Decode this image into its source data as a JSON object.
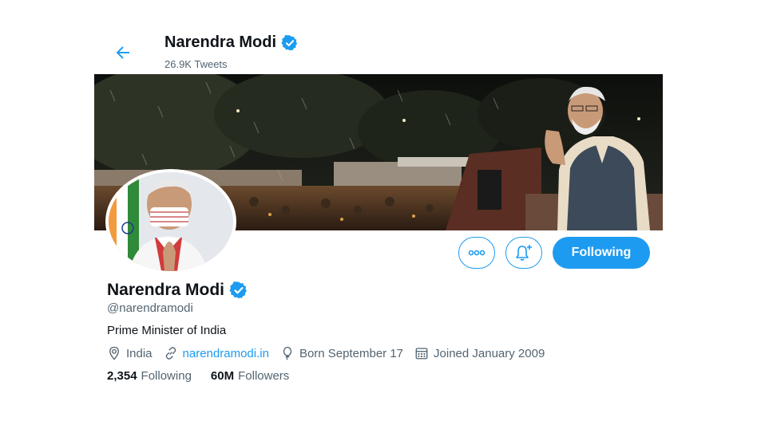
{
  "header": {
    "name": "Narendra Modi",
    "tweets_count": "26.9K Tweets"
  },
  "profile": {
    "name": "Narendra Modi",
    "handle": "@narendramodi",
    "bio": "Prime Minister of India",
    "location": "India",
    "website": "narendramodi.in",
    "birthday": "Born September 17",
    "joined": "Joined January 2009"
  },
  "actions": {
    "follow_label": "Following"
  },
  "stats": {
    "following_count": "2,354",
    "following_label": "Following",
    "followers_count": "60M",
    "followers_label": "Followers"
  },
  "colors": {
    "accent": "#1d9bf0",
    "text": "#0f1419",
    "muted": "#536471"
  },
  "icons": [
    "back-arrow-icon",
    "verified-badge-icon",
    "more-icon",
    "bell-plus-icon",
    "location-icon",
    "link-icon",
    "balloon-icon",
    "calendar-icon"
  ]
}
